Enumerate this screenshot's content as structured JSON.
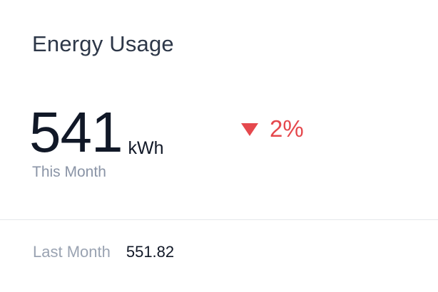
{
  "card": {
    "title": "Energy Usage",
    "metric": {
      "value": "541",
      "unit": "kWh",
      "period_label": "This Month"
    },
    "change": {
      "direction": "down",
      "icon": "triangle-down-icon",
      "text": "2%",
      "color": "#e5484d"
    },
    "footer": {
      "label": "Last Month",
      "value": "551.82"
    }
  }
}
